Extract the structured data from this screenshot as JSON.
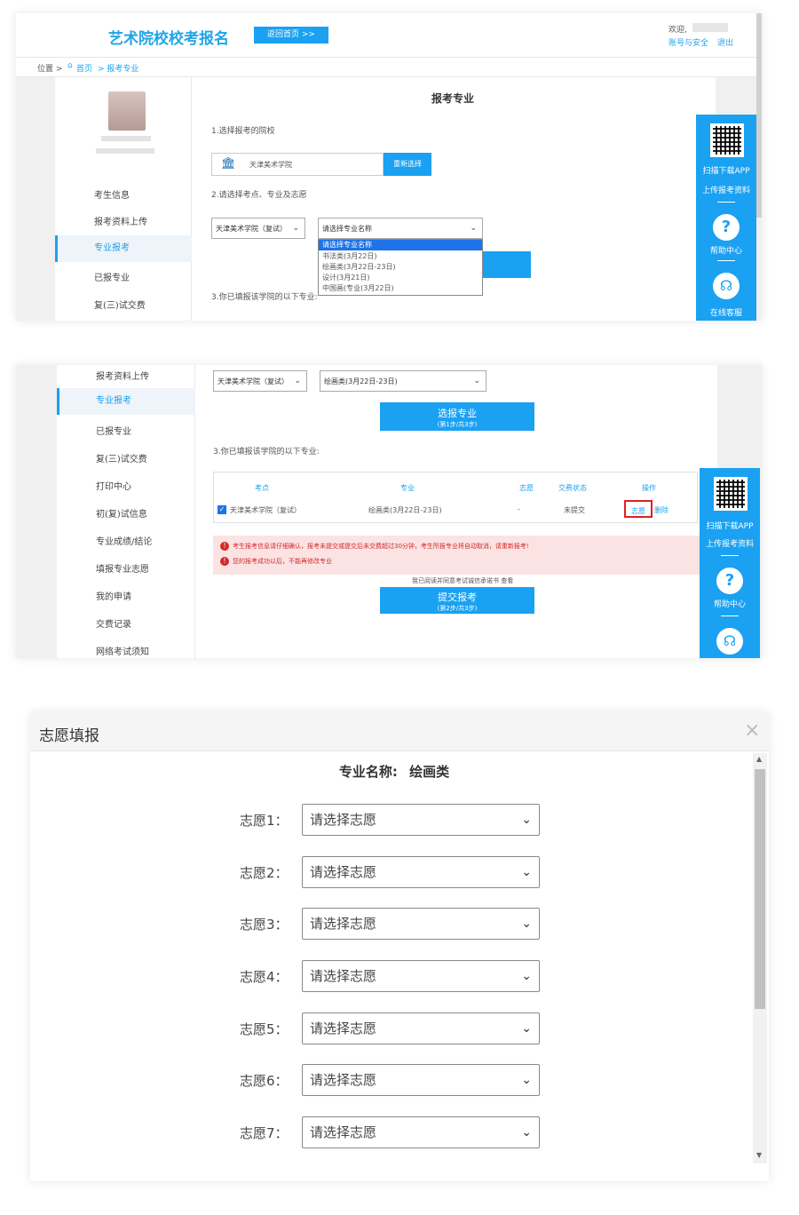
{
  "panel1": {
    "site_title": "艺术院校校考报名",
    "home_button": "返回首页 >>",
    "greeting": "欢迎,",
    "account_security": "账号与安全",
    "logout": "退出",
    "breadcrumb": {
      "position": "位置 >",
      "home": "首页",
      "current": "> 报考专业"
    },
    "page_title": "报考专业",
    "step1": "1.选择报考的院校",
    "school_name": "天津美术学院",
    "reselect_button": "重新选择",
    "step2": "2.请选择考点、专业及志愿",
    "exam_site_select": "天津美术学院（复试）",
    "major_select": "请选择专业名称",
    "dropdown_options": [
      "请选择专业名称",
      "书法类(3月22日)",
      "绘画类(3月22日-23日)",
      "设计(3月21日)",
      "中国画(专业(3月22日)"
    ],
    "step3": "3.你已填报该学院的以下专业:",
    "sidebar": [
      "考生信息",
      "报考资料上传",
      "专业报考",
      "已报专业",
      "复(三)试交费"
    ],
    "float_bar": {
      "download_app": "扫描下载APP",
      "upload": "上传报考资料",
      "help": "帮助中心",
      "service": "在线客服"
    }
  },
  "panel2": {
    "exam_site_select": "天津美术学院（复试）",
    "major_select": "绘画类(3月22日-23日)",
    "select_button_title": "选报专业",
    "select_button_sub": "(第1步/共3步)",
    "step3": "3.你已填报该学院的以下专业:",
    "table_headers": [
      "考点",
      "专业",
      "志愿",
      "交费状态",
      "操作"
    ],
    "row": {
      "site": "天津美术学院（复试）",
      "major": "绘画类(3月22日-23日)",
      "wish": "-",
      "pay_status": "未提交",
      "action_wish": "志愿",
      "action_delete": "删除"
    },
    "warnings": [
      "考生报考信息请仔细确认，报考未提交或提交后未交费超过30分钟，考生所报专业将自动取消，请重新报考!",
      "您的报考成功以后，不能再修改专业"
    ],
    "agree_text": "我已阅读并同意考试诚信承诺书 查看",
    "submit_button_title": "提交报考",
    "submit_button_sub": "(第2步/共3步)",
    "sidebar": [
      "报考资料上传",
      "专业报考",
      "已报专业",
      "复(三)试交费",
      "打印中心",
      "初(复)试信息",
      "专业成绩/结论",
      "填报专业志愿",
      "我的申请",
      "交费记录",
      "网络考试须知"
    ],
    "float_bar": {
      "download_app": "扫描下载APP",
      "upload": "上传报考资料",
      "help": "帮助中心"
    }
  },
  "panel3": {
    "dialog_title": "志愿填报",
    "major_label": "专业名称:",
    "major_value": "绘画类",
    "wishes": [
      {
        "label": "志愿1：",
        "value": "请选择志愿"
      },
      {
        "label": "志愿2：",
        "value": "请选择志愿"
      },
      {
        "label": "志愿3：",
        "value": "请选择志愿"
      },
      {
        "label": "志愿4：",
        "value": "请选择志愿"
      },
      {
        "label": "志愿5：",
        "value": "请选择志愿"
      },
      {
        "label": "志愿6：",
        "value": "请选择志愿"
      },
      {
        "label": "志愿7：",
        "value": "请选择志愿"
      }
    ]
  },
  "colors": {
    "accent": "#1aa1f2",
    "warning_bg": "#fbe3e3",
    "warning_text": "#d42a2a"
  }
}
